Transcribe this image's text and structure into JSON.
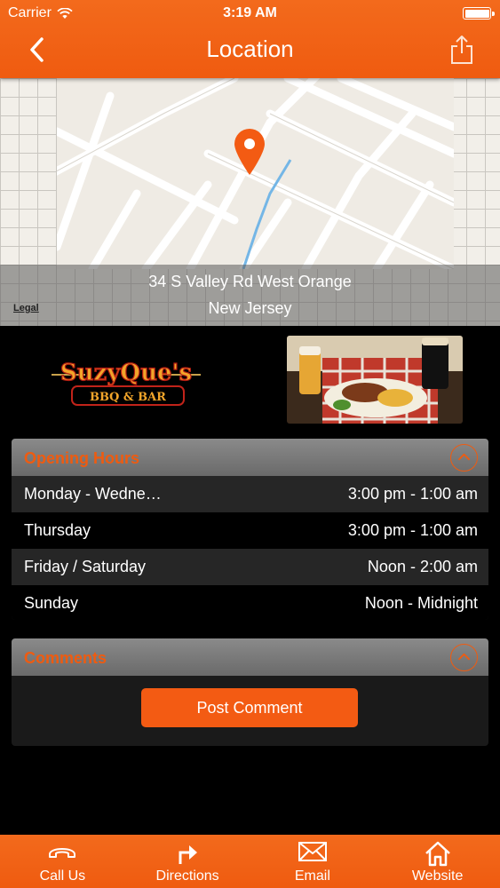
{
  "status": {
    "carrier": "Carrier",
    "time": "3:19 AM"
  },
  "nav": {
    "title": "Location",
    "back_icon": "chevron-left-icon",
    "share_icon": "share-icon"
  },
  "map": {
    "address_line1": "34 S Valley Rd West Orange",
    "address_line2": "New Jersey",
    "legal": "Legal"
  },
  "brand": {
    "logo_text": "SuzyQue's",
    "logo_subtext": "BBQ & BAR"
  },
  "hours": {
    "title": "Opening Hours",
    "rows": [
      {
        "day": "Monday - Wedne…",
        "time": "3:00 pm - 1:00 am"
      },
      {
        "day": "Thursday",
        "time": "3:00 pm - 1:00 am"
      },
      {
        "day": "Friday / Saturday",
        "time": "Noon - 2:00 am"
      },
      {
        "day": "Sunday",
        "time": "Noon - Midnight"
      }
    ]
  },
  "comments": {
    "title": "Comments",
    "button": "Post Comment"
  },
  "tabs": [
    {
      "label": "Call Us",
      "icon": "phone-icon"
    },
    {
      "label": "Directions",
      "icon": "directions-arrow-icon"
    },
    {
      "label": "Email",
      "icon": "envelope-icon"
    },
    {
      "label": "Website",
      "icon": "home-icon"
    }
  ],
  "colors": {
    "accent": "#ef5b10",
    "panel_header": "#7a7a7a",
    "background": "#000000"
  }
}
